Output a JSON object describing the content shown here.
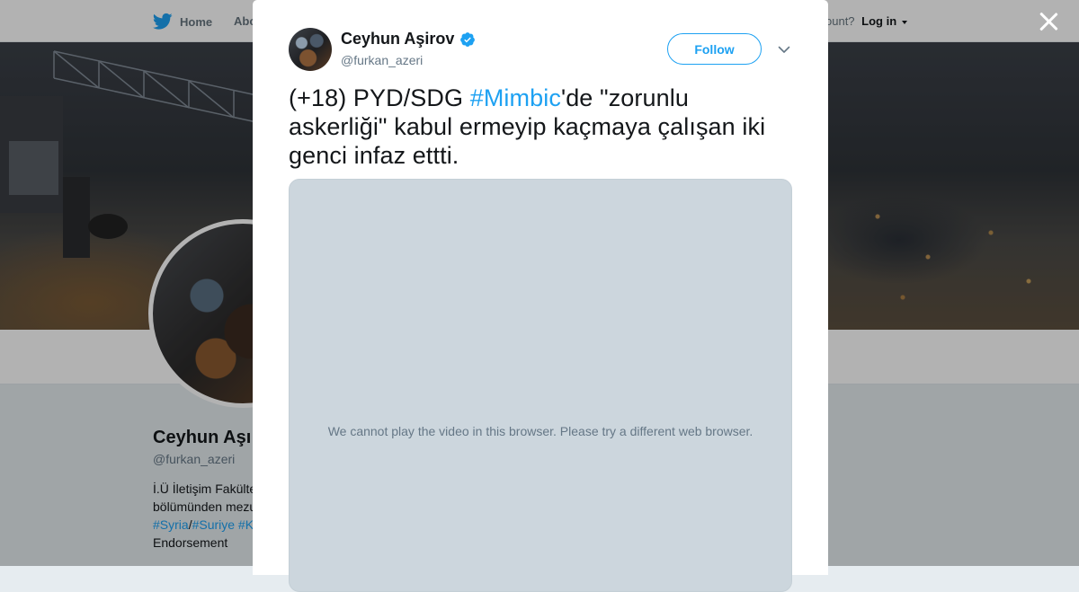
{
  "topnav": {
    "home_label": "Home",
    "about_label": "Abo",
    "account_prompt": "ccount?",
    "login_label": "Log in"
  },
  "profile": {
    "name": "Ceyhun Aşı",
    "handle": "@furkan_azeri",
    "bio_lines": [
      "İ.Ü İletişim Fakülte",
      "bölümünden mezu",
      "Endorsement"
    ],
    "bio_hashtags": [
      "#Syria",
      "/",
      "#Suriye",
      " #K"
    ]
  },
  "tweet": {
    "author_name": "Ceyhun Aşirov",
    "author_handle": "@furkan_azeri",
    "follow_label": "Follow",
    "text_before": "(+18) PYD/SDG ",
    "hashtag": "#Mimbic",
    "text_after": "'de \"zorunlu askerliği\" kabul ermeyip kaçmaya çalışan iki genci infaz ettti.",
    "video_message": "We cannot play the video in this browser. Please try a different web browser."
  },
  "icons": {
    "twitter_bird": "twitter-bird-icon",
    "verified": "verified-badge-icon",
    "caret": "chevron-down-icon",
    "close": "close-icon"
  },
  "colors": {
    "accent": "#1da1f2",
    "text": "#14171a",
    "secondary_text": "#657786",
    "media_placeholder": "#ccd6dd"
  }
}
